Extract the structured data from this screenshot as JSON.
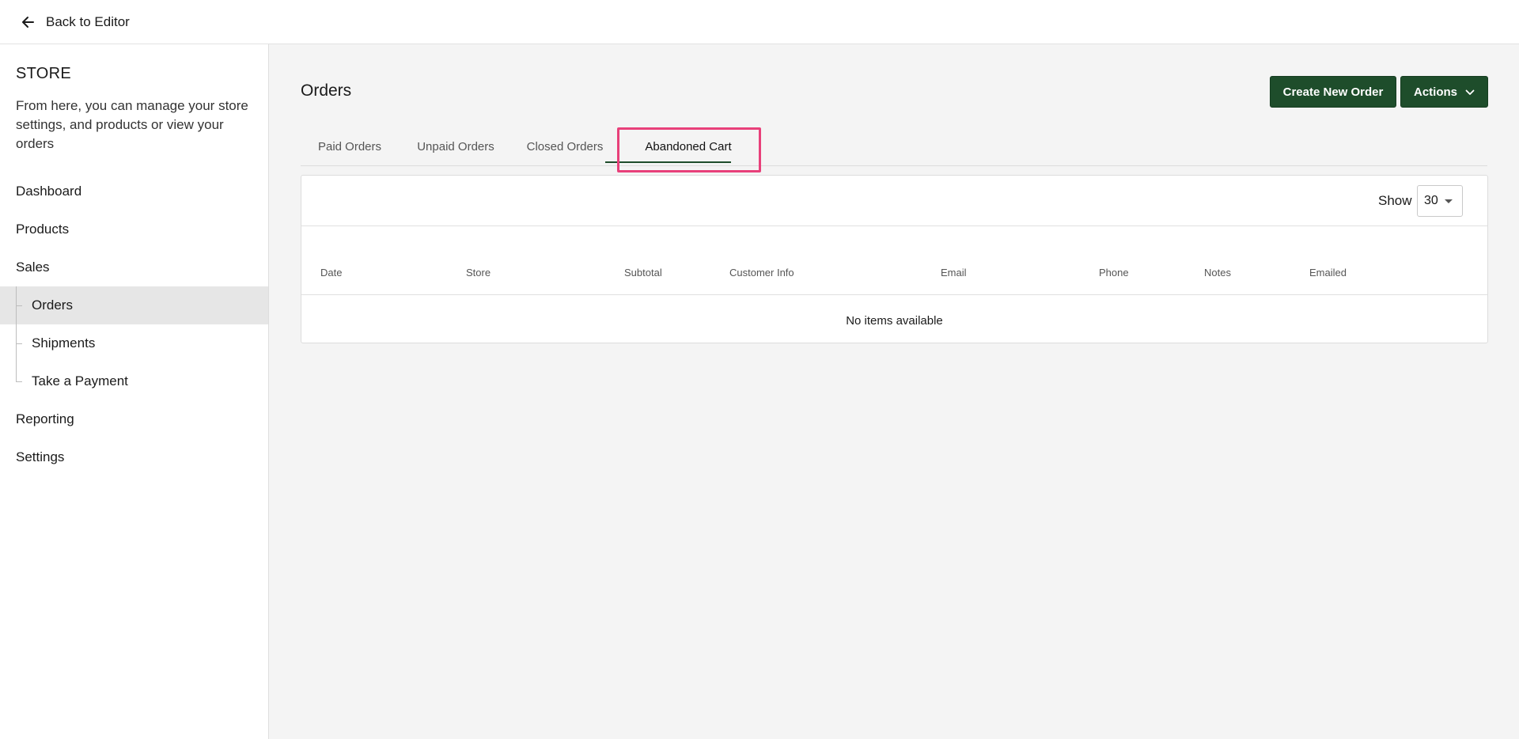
{
  "topbar": {
    "back_label": "Back to Editor",
    "back_icon": "arrow-left-icon"
  },
  "sidebar": {
    "title": "STORE",
    "description": "From here, you can manage your store settings, and products or view your orders",
    "items": [
      {
        "label": "Dashboard"
      },
      {
        "label": "Products"
      },
      {
        "label": "Sales"
      },
      {
        "label": "Orders",
        "active": true
      },
      {
        "label": "Shipments"
      },
      {
        "label": "Take a Payment"
      },
      {
        "label": "Reporting"
      },
      {
        "label": "Settings"
      }
    ]
  },
  "main": {
    "title": "Orders",
    "buttons": {
      "create": "Create New Order",
      "actions": "Actions"
    },
    "tabs": [
      {
        "label": "Paid Orders"
      },
      {
        "label": "Unpaid Orders"
      },
      {
        "label": "Closed Orders"
      },
      {
        "label": "Abandoned Cart",
        "active": true
      }
    ],
    "table": {
      "show_label": "Show",
      "page_size": "30",
      "columns": [
        "Date",
        "Store",
        "Subtotal",
        "Customer Info",
        "Email",
        "Phone",
        "Notes",
        "Emailed"
      ],
      "empty_message": "No items available"
    }
  },
  "colors": {
    "primary_button": "#1e4d2b",
    "highlight": "#e8407a",
    "active_nav": "#e6e6e6",
    "main_bg": "#f4f4f4"
  }
}
